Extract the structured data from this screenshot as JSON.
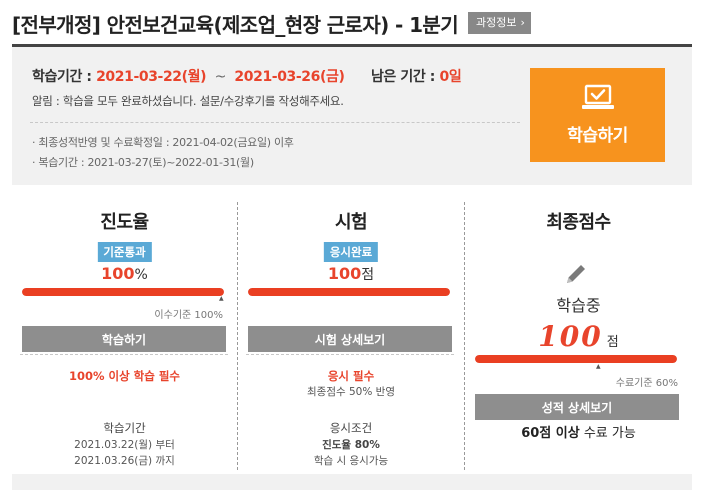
{
  "header": {
    "course_title": "[전부개정] 안전보건교육(제조업_현장 근로자) - 1분기",
    "info_button": "과정정보"
  },
  "info_box": {
    "period_label": "학습기간 :",
    "start_date": "2021-03-22(월)",
    "tilde": "~",
    "end_date": "2021-03-26(금)",
    "remain_label": "남은 기간 :",
    "remain_value": "0일",
    "notice": "알림 : 학습을 모두 완료하셨습니다. 설문/수강후기를 작성해주세요.",
    "bullets": [
      "· 최종성적반영 및 수료확정일 : 2021-04-02(금요일) 이후",
      "· 복습기간 : 2021-03-27(토)~2022-01-31(월)"
    ],
    "study_button": "학습하기"
  },
  "progress": {
    "title": "진도율",
    "badge": "기준통과",
    "value": "100",
    "unit": "%",
    "fill_fraction": 1.0,
    "threshold_note": "이수기준 100%",
    "button": "학습하기",
    "requirement": "100% 이상 학습 필수",
    "period_heading": "학습기간",
    "period_from": "2021.03.22(월) 부터",
    "period_to": "2021.03.26(금) 까지"
  },
  "exam": {
    "title": "시험",
    "badge": "응시완료",
    "value": "100",
    "unit": "점",
    "fill_fraction": 1.0,
    "button": "시험 상세보기",
    "requirement": "응시 필수",
    "reflect_note": "최종점수 50% 반영",
    "cond_heading": "응시조건",
    "cond_1": "진도율 80%",
    "cond_2": "학습 시 응시가능"
  },
  "final": {
    "title": "최종점수",
    "status": "학습중",
    "score": "100",
    "unit": "점",
    "fill_fraction": 1.0,
    "threshold_note": "수료기준 60%",
    "button": "성적 상세보기",
    "complete_bold": "60점 이상",
    "complete_rest": " 수료 가능"
  },
  "colors": {
    "accent_orange": "#f7931e",
    "accent_red": "#e8442c",
    "badge_blue": "#5aa9d6",
    "button_gray": "#8e8e8e"
  },
  "icons": {
    "study": "laptop-check-icon",
    "status": "pencil-icon"
  }
}
